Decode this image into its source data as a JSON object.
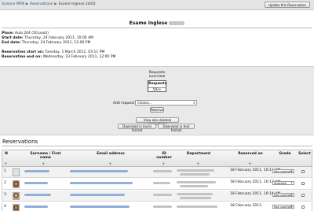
{
  "breadcrumb": {
    "items": [
      "Science MFN",
      "Reservations",
      "Esame Inglese 24/02"
    ]
  },
  "header": {
    "update_button": "Update this Reservation"
  },
  "page_title": "Esame Inglese",
  "details": {
    "place_label": "Place:",
    "place_value": "Aula 204 (50 posti)",
    "start_label": "Start date:",
    "start_value": "Thursday, 24 February 2011, 10:00 AM",
    "end_label": "End date:",
    "end_value": "Thursday, 24 February 2011, 12:00 PM",
    "res_start_label": "Reservation start on:",
    "res_start_value": "Tuesday, 1 March 2011, 03:11 PM",
    "res_end_label": "Reservation end on:",
    "res_end_value": "Wednesday, 23 February 2011, 12:00 PM"
  },
  "requests": {
    "overview_line1": "Requests",
    "overview_line2": "overview",
    "box_label": "Requests",
    "box_value": "59/∞"
  },
  "add_request": {
    "label": "Add request",
    "select_value": "Choose...",
    "reserve_button": "Reserve"
  },
  "actions": {
    "view_deleted": "View also deleted reservations",
    "download_excel": "Download in Excel format",
    "download_text": "Download in text format"
  },
  "reservations": {
    "title": "Reservations",
    "columns": {
      "n": "N",
      "surname": "Surname / First name",
      "email": "Email address",
      "id_number": "ID number",
      "department": "Department",
      "reserved_on": "Reserved on",
      "grade": "Grade",
      "select": "Select"
    },
    "rows": [
      {
        "n": "1",
        "reserved_on": "18 February 2011, 10:11 AM",
        "grade": "Non superato"
      },
      {
        "n": "2",
        "reserved_on": "18 February 2011, 10:12 AM",
        "grade": "Superato"
      },
      {
        "n": "3",
        "reserved_on": "18 February 2011, 10:14 AM",
        "grade": "Non superato"
      },
      {
        "n": "4",
        "reserved_on": "18 February 2011,",
        "grade": "Non superato"
      }
    ]
  },
  "colors": {
    "link": "#1b4fa6",
    "panel": "#e9e9e9",
    "row_alt": "#f2f2f2"
  }
}
